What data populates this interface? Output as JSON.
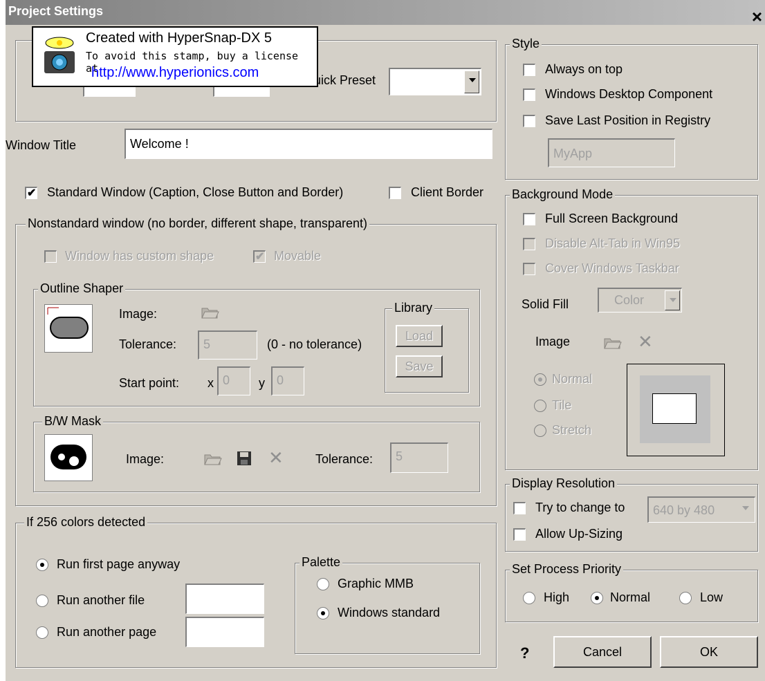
{
  "window": {
    "title": "Project Settings",
    "close": "×"
  },
  "stamp": {
    "line1": "Created with HyperSnap-DX 5",
    "line2": "To avoid this stamp, buy a license at",
    "line3": "http://www.hyperionics.com"
  },
  "size": {
    "quick_preset_label": "uick Preset",
    "quick_preset_value": ""
  },
  "window_title": {
    "label": "Window Title",
    "value": "Welcome !"
  },
  "standard_window": {
    "label": "Standard Window (Caption, Close Button and Border)",
    "checked": true
  },
  "client_border": {
    "label": "Client Border",
    "checked": false
  },
  "nonstandard": {
    "legend": "Nonstandard window (no border, different shape, transparent)",
    "custom_shape_label": "Window has custom shape",
    "movable_label": "Movable",
    "outline": {
      "legend": "Outline Shaper",
      "image_label": "Image:",
      "tolerance_label": "Tolerance:",
      "tolerance_value": "5",
      "tolerance_hint": "(0 - no tolerance)",
      "start_label": "Start point:",
      "x_label": "x",
      "x_value": "0",
      "y_label": "y",
      "y_value": "0",
      "library_legend": "Library",
      "load_label": "Load",
      "save_label": "Save"
    },
    "mask": {
      "legend": "B/W Mask",
      "image_label": "Image:",
      "tolerance_label": "Tolerance:",
      "tolerance_value": "5"
    }
  },
  "colors256": {
    "legend": "If 256 colors detected",
    "run_first": "Run first page anyway",
    "run_file": "Run another file",
    "run_page": "Run another page",
    "palette_legend": "Palette",
    "graphic_mmb": "Graphic MMB",
    "windows_standard": "Windows standard"
  },
  "style": {
    "legend": "Style",
    "always_on_top": "Always on top",
    "desktop_component": "Windows Desktop Component",
    "save_position": "Save Last Position in Registry",
    "registry_key": "MyApp"
  },
  "background": {
    "legend": "Background Mode",
    "full_screen": "Full Screen Background",
    "disable_alt_tab": "Disable Alt-Tab in Win95",
    "cover_taskbar": "Cover Windows Taskbar",
    "solid_fill_label": "Solid Fill",
    "solid_fill_value": "Color",
    "image_label": "Image",
    "normal": "Normal",
    "tile": "Tile",
    "stretch": "Stretch"
  },
  "resolution": {
    "legend": "Display Resolution",
    "try_change": "Try to change to",
    "value": "640 by 480",
    "allow_upsizing": "Allow Up-Sizing"
  },
  "priority": {
    "legend": "Set Process Priority",
    "high": "High",
    "normal": "Normal",
    "low": "Low"
  },
  "buttons": {
    "help": "?",
    "cancel": "Cancel",
    "ok": "OK"
  }
}
